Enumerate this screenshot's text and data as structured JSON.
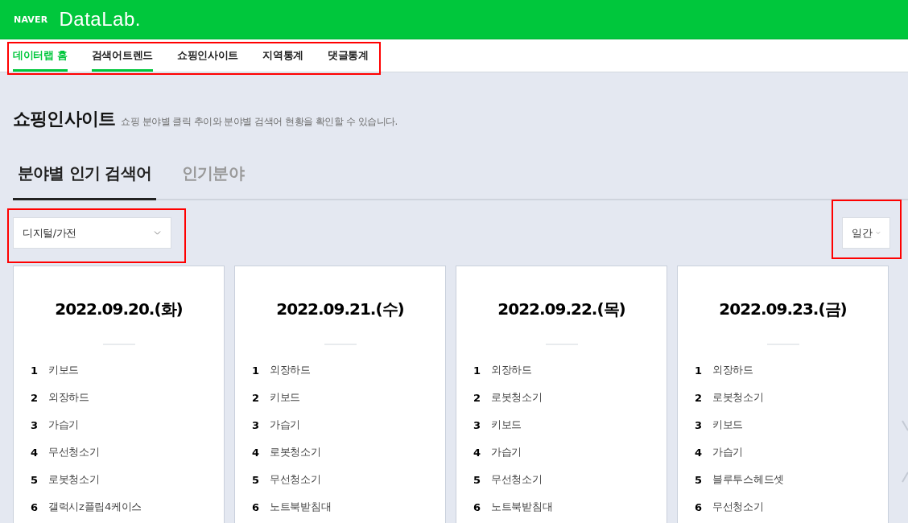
{
  "header": {
    "logo": "NAVER",
    "product": "DataLab."
  },
  "nav": {
    "highlighted": true,
    "tabs": [
      {
        "label": "데이터랩 홈",
        "selected": true,
        "underlined": true
      },
      {
        "label": "검색어트렌드",
        "selected": false,
        "underlined": true
      },
      {
        "label": "쇼핑인사이트",
        "selected": false,
        "underlined": false
      },
      {
        "label": "지역통계",
        "selected": false,
        "underlined": false
      },
      {
        "label": "댓글통계",
        "selected": false,
        "underlined": false
      }
    ]
  },
  "page": {
    "title": "쇼핑인사이트",
    "description": "쇼핑 분야별 클릭 추이와 분야별 검색어 현황을 확인할 수 있습니다."
  },
  "sub_tabs": [
    {
      "label": "분야별 인기 검색어",
      "selected": true
    },
    {
      "label": "인기분야",
      "selected": false
    }
  ],
  "category_select": {
    "value": "디지털/가전",
    "highlighted": true
  },
  "period_select": {
    "value": "일간",
    "highlighted": true
  },
  "days": [
    {
      "date": "2022.09.20.(화)",
      "keywords": [
        {
          "rank": "1",
          "term": "키보드"
        },
        {
          "rank": "2",
          "term": "외장하드"
        },
        {
          "rank": "3",
          "term": "가습기"
        },
        {
          "rank": "4",
          "term": "무선청소기"
        },
        {
          "rank": "5",
          "term": "로봇청소기"
        },
        {
          "rank": "6",
          "term": "갤럭시z플립4케이스"
        }
      ]
    },
    {
      "date": "2022.09.21.(수)",
      "keywords": [
        {
          "rank": "1",
          "term": "외장하드"
        },
        {
          "rank": "2",
          "term": "키보드"
        },
        {
          "rank": "3",
          "term": "가습기"
        },
        {
          "rank": "4",
          "term": "로봇청소기"
        },
        {
          "rank": "5",
          "term": "무선청소기"
        },
        {
          "rank": "6",
          "term": "노트북받침대"
        }
      ]
    },
    {
      "date": "2022.09.22.(목)",
      "keywords": [
        {
          "rank": "1",
          "term": "외장하드"
        },
        {
          "rank": "2",
          "term": "로봇청소기"
        },
        {
          "rank": "3",
          "term": "키보드"
        },
        {
          "rank": "4",
          "term": "가습기"
        },
        {
          "rank": "5",
          "term": "무선청소기"
        },
        {
          "rank": "6",
          "term": "노트북받침대"
        }
      ]
    },
    {
      "date": "2022.09.23.(금)",
      "keywords": [
        {
          "rank": "1",
          "term": "외장하드"
        },
        {
          "rank": "2",
          "term": "로봇청소기"
        },
        {
          "rank": "3",
          "term": "키보드"
        },
        {
          "rank": "4",
          "term": "가습기"
        },
        {
          "rank": "5",
          "term": "블루투스헤드셋"
        },
        {
          "rank": "6",
          "term": "무선청소기"
        }
      ]
    }
  ]
}
